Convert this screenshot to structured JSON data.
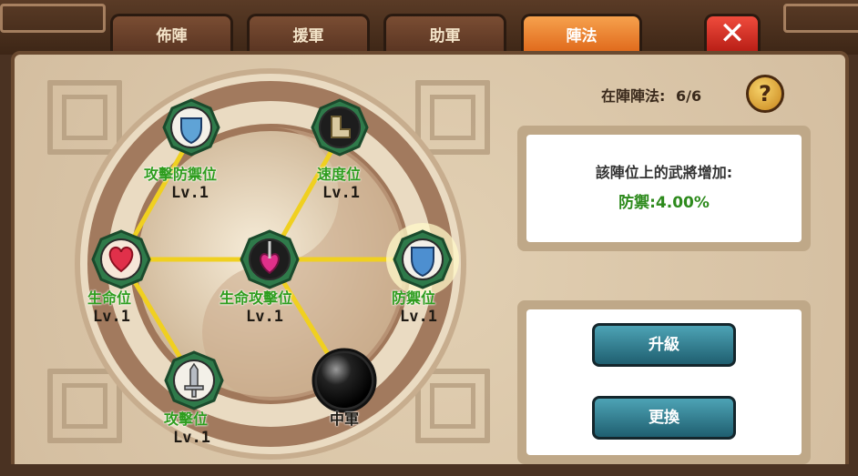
{
  "tabs": [
    {
      "label": "佈陣",
      "active": false
    },
    {
      "label": "援軍",
      "active": false
    },
    {
      "label": "助軍",
      "active": false
    },
    {
      "label": "陣法",
      "active": true
    }
  ],
  "close_icon": "close-icon",
  "formation": {
    "count_label": "在陣陣法:",
    "count_value": "6/6",
    "help_icon": "question-icon"
  },
  "info": {
    "title": "該陣位上的武將增加:",
    "bonus": "防禦:4.00%"
  },
  "buttons": {
    "upgrade": "升級",
    "replace": "更換"
  },
  "nodes": [
    {
      "id": "attack-defense",
      "name": "攻擊防禦位",
      "level": "Lv.1",
      "icon": "shield-swords-icon"
    },
    {
      "id": "speed",
      "name": "速度位",
      "level": "Lv.1",
      "icon": "boot-icon"
    },
    {
      "id": "hp",
      "name": "生命位",
      "level": "Lv.1",
      "icon": "heart-icon"
    },
    {
      "id": "hp-attack",
      "name": "生命攻擊位",
      "level": "Lv.1",
      "icon": "heart-sword-icon"
    },
    {
      "id": "defense",
      "name": "防禦位",
      "level": "Lv.1",
      "icon": "shield-icon"
    },
    {
      "id": "attack",
      "name": "攻擊位",
      "level": "Lv.1",
      "icon": "sword-icon"
    },
    {
      "id": "center",
      "name": "中軍",
      "level": "",
      "icon": "black-orb-icon"
    }
  ],
  "colors": {
    "tab_active": "#e06a1c",
    "node_green": "#2f7a4a",
    "label_green": "#2e9d1e",
    "link_yellow": "#f0d020",
    "button_teal": "#1f5f70"
  }
}
